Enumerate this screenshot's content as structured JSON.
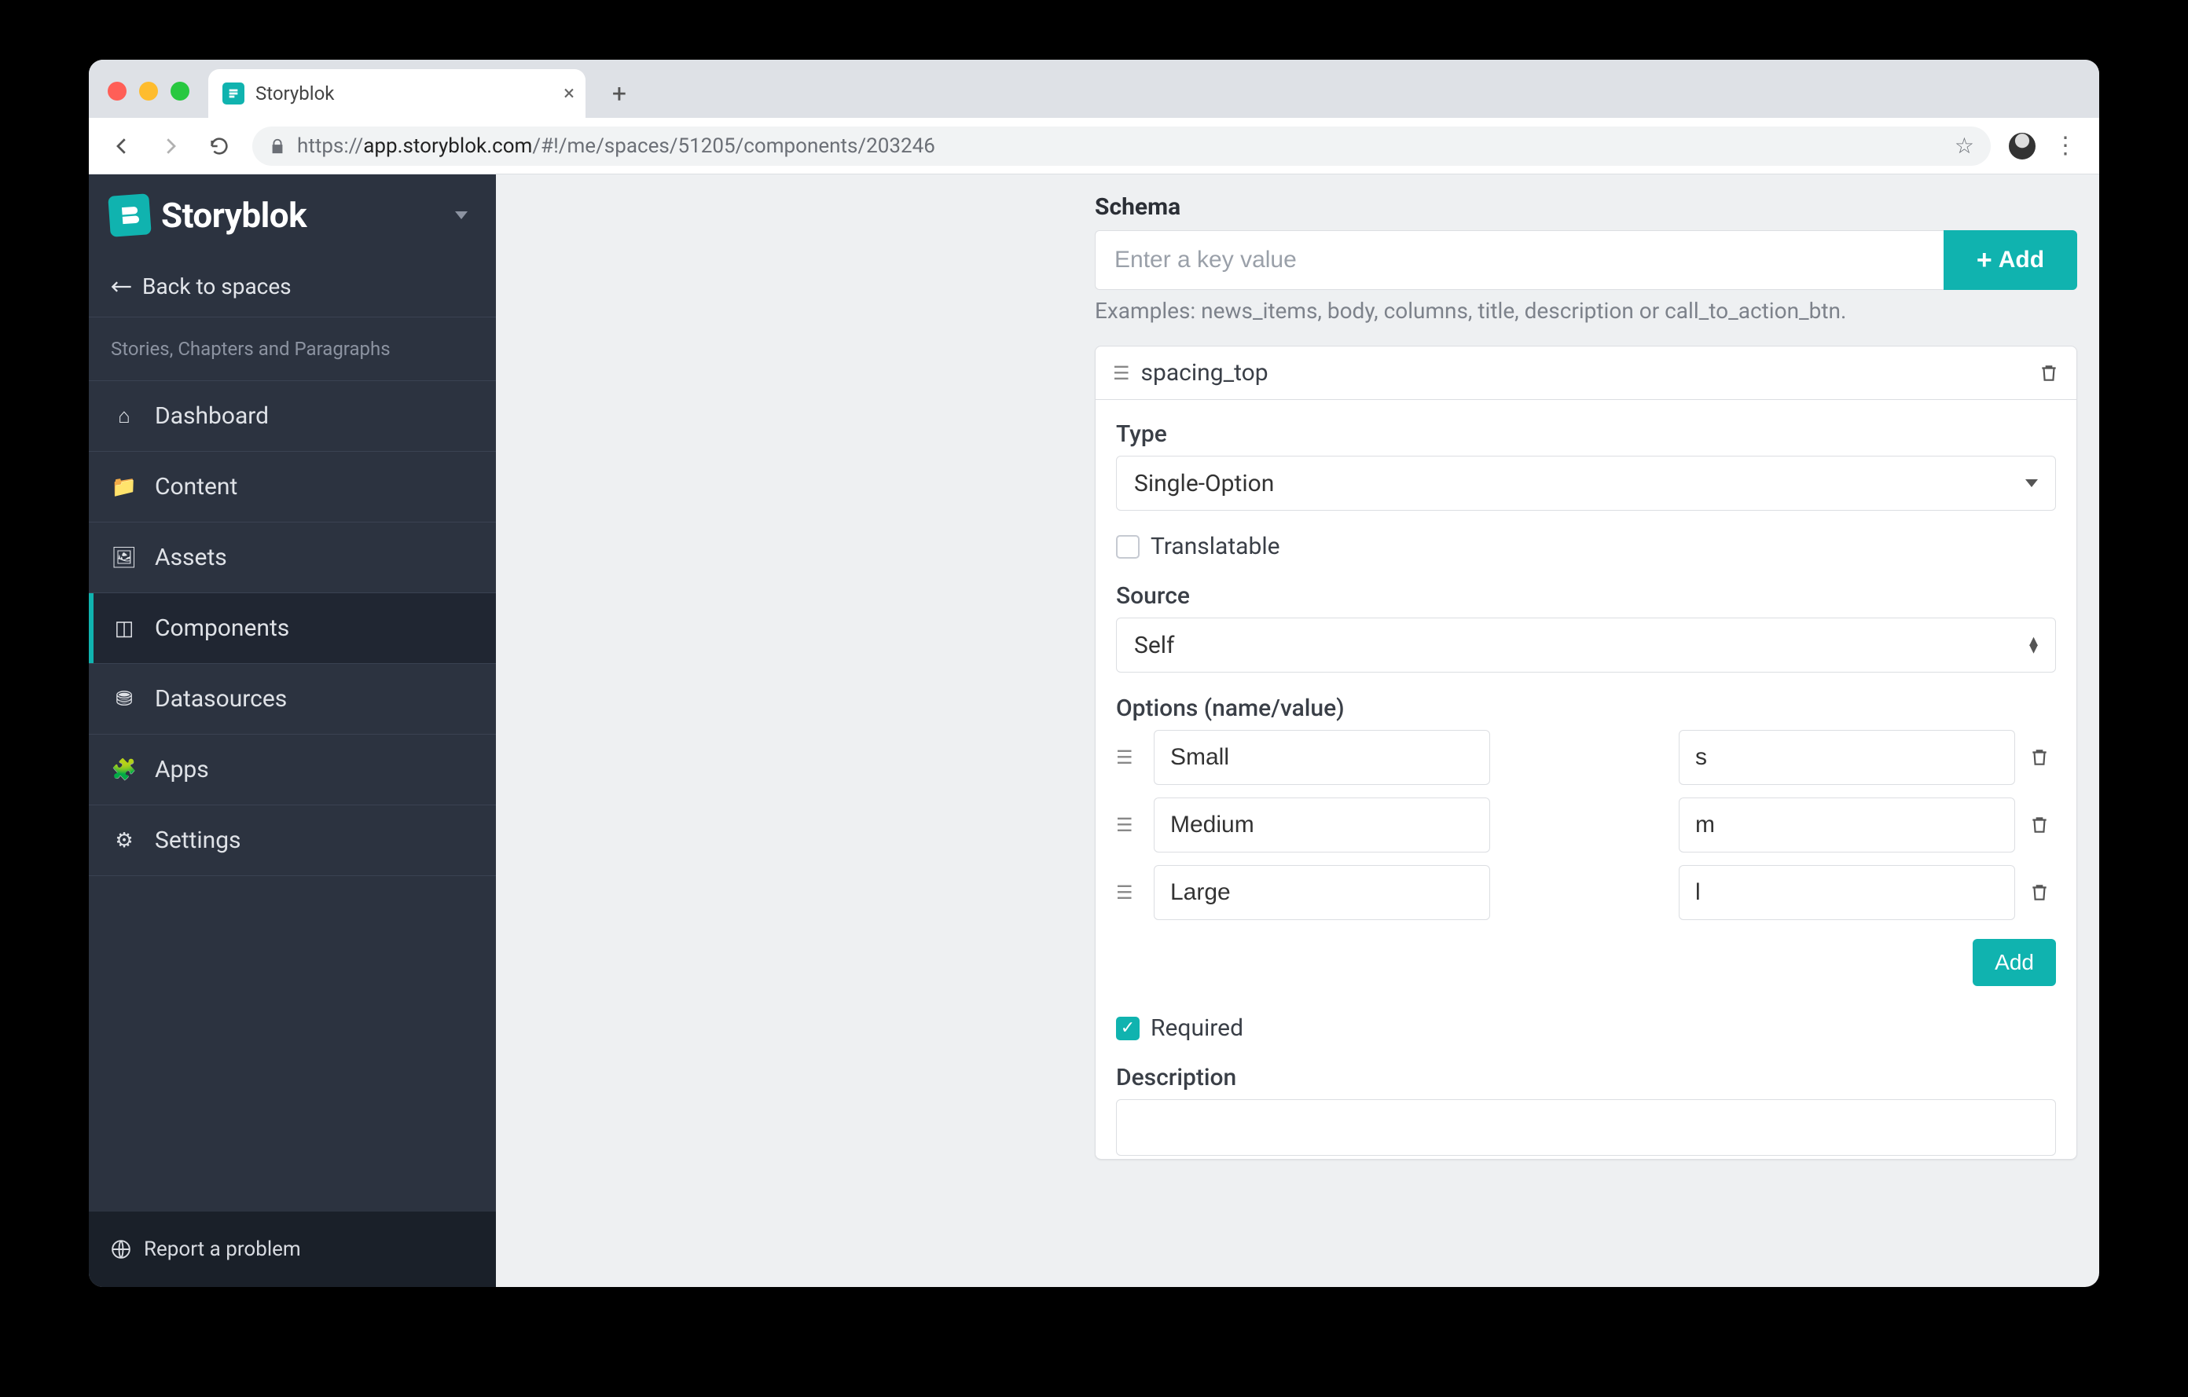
{
  "browser": {
    "tab_title": "Storyblok",
    "url_prefix": "https://",
    "url_host": "app.storyblok.com",
    "url_path": "/#!/me/spaces/51205/components/203246"
  },
  "sidebar": {
    "brand": "Storyblok",
    "back_label": "Back to spaces",
    "subtitle": "Stories, Chapters and Paragraphs",
    "items": [
      {
        "label": "Dashboard",
        "name": "sidebar-item-dashboard",
        "icon": "home-icon",
        "glyph": "⌂",
        "active": false
      },
      {
        "label": "Content",
        "name": "sidebar-item-content",
        "icon": "folder-icon",
        "glyph": "📁",
        "active": false
      },
      {
        "label": "Assets",
        "name": "sidebar-item-assets",
        "icon": "image-icon",
        "glyph": "🖼",
        "active": false
      },
      {
        "label": "Components",
        "name": "sidebar-item-components",
        "icon": "blocks-icon",
        "glyph": "◫",
        "active": true
      },
      {
        "label": "Datasources",
        "name": "sidebar-item-datasources",
        "icon": "database-icon",
        "glyph": "⛃",
        "active": false
      },
      {
        "label": "Apps",
        "name": "sidebar-item-apps",
        "icon": "puzzle-icon",
        "glyph": "🧩",
        "active": false
      },
      {
        "label": "Settings",
        "name": "sidebar-item-settings",
        "icon": "gear-icon",
        "glyph": "⚙",
        "active": false
      }
    ],
    "report_label": "Report a problem"
  },
  "schema": {
    "heading": "Schema",
    "key_placeholder": "Enter a key value",
    "add_label": "Add",
    "examples": "Examples: news_items, body, columns, title, description or call_to_action_btn.",
    "field_name": "spacing_top",
    "type_label": "Type",
    "type_value": "Single-Option",
    "translatable_label": "Translatable",
    "translatable_checked": false,
    "source_label": "Source",
    "source_value": "Self",
    "options_label": "Options (name/value)",
    "options": [
      {
        "name": "Small",
        "value": "s"
      },
      {
        "name": "Medium",
        "value": "m"
      },
      {
        "name": "Large",
        "value": "l"
      }
    ],
    "options_add_label": "Add",
    "required_label": "Required",
    "required_checked": true,
    "description_label": "Description",
    "description_value": ""
  }
}
